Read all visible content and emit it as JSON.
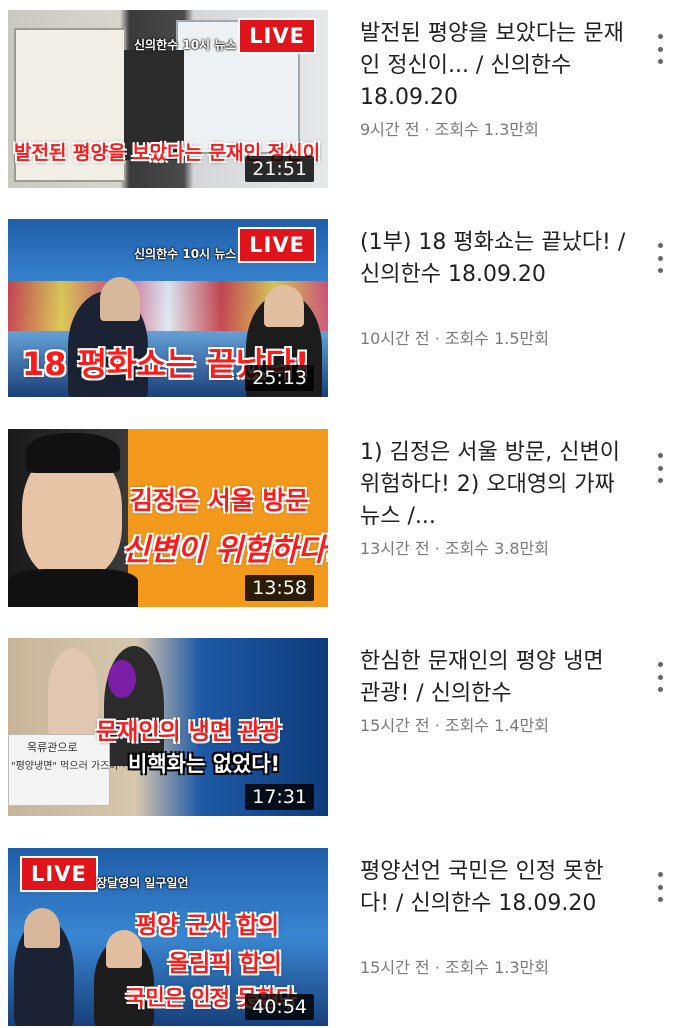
{
  "videos": [
    {
      "title": "발전된 평양을 보았다는 문재인 정신이... / 신의한수 18.09.20",
      "meta": "9시간 전 · 조회수 1.3만회",
      "duration": "21:51",
      "live_badge": "LIVE",
      "channel_tag": "신의한수 10시 뉴스",
      "caption": [
        "발전된 평양을 보았다는 문재인 정신이"
      ]
    },
    {
      "title": "(1부) 18 평화쇼는 끝났다! / 신의한수 18.09.20",
      "meta": "10시간 전 · 조회수 1.5만회",
      "duration": "25:13",
      "live_badge": "LIVE",
      "channel_tag": "신의한수 10시 뉴스",
      "caption": [
        "18 평화쇼는 끝났다!"
      ]
    },
    {
      "title": "1) 김정은 서울 방문, 신변이 위험하다! 2) 오대영의 가짜뉴스 /...",
      "meta": "13시간 전 · 조회수 3.8만회",
      "duration": "13:58",
      "caption": [
        "김정은 서울 방문",
        "신변이 위험하다!"
      ]
    },
    {
      "title": "한심한 문재인의 평양 냉면 관광! / 신의한수",
      "meta": "15시간 전 · 조회수 1.4만회",
      "duration": "17:31",
      "caption": [
        "문재인의 냉면 관광",
        "비핵화는 없었다!"
      ],
      "banner_text": [
        "옥류관으로",
        "\"평양냉면\" 먹으러 가즈아~!"
      ]
    },
    {
      "title": "평양선언 국민은 인정 못한다! / 신의한수 18.09.20",
      "meta": "15시간 전 · 조회수 1.3만회",
      "duration": "40:54",
      "live_badge": "LIVE",
      "channel_tag": "장달영의 일구일언",
      "caption": [
        "평양 군사 합의",
        "올림픽 합의",
        "국민은 인정 못한다"
      ]
    }
  ],
  "colors": {
    "live_red": "#e0151c",
    "caption_red": "#ff1a1a",
    "orange_bg": "#f39a1d",
    "meta_gray": "#7a7a7a"
  }
}
